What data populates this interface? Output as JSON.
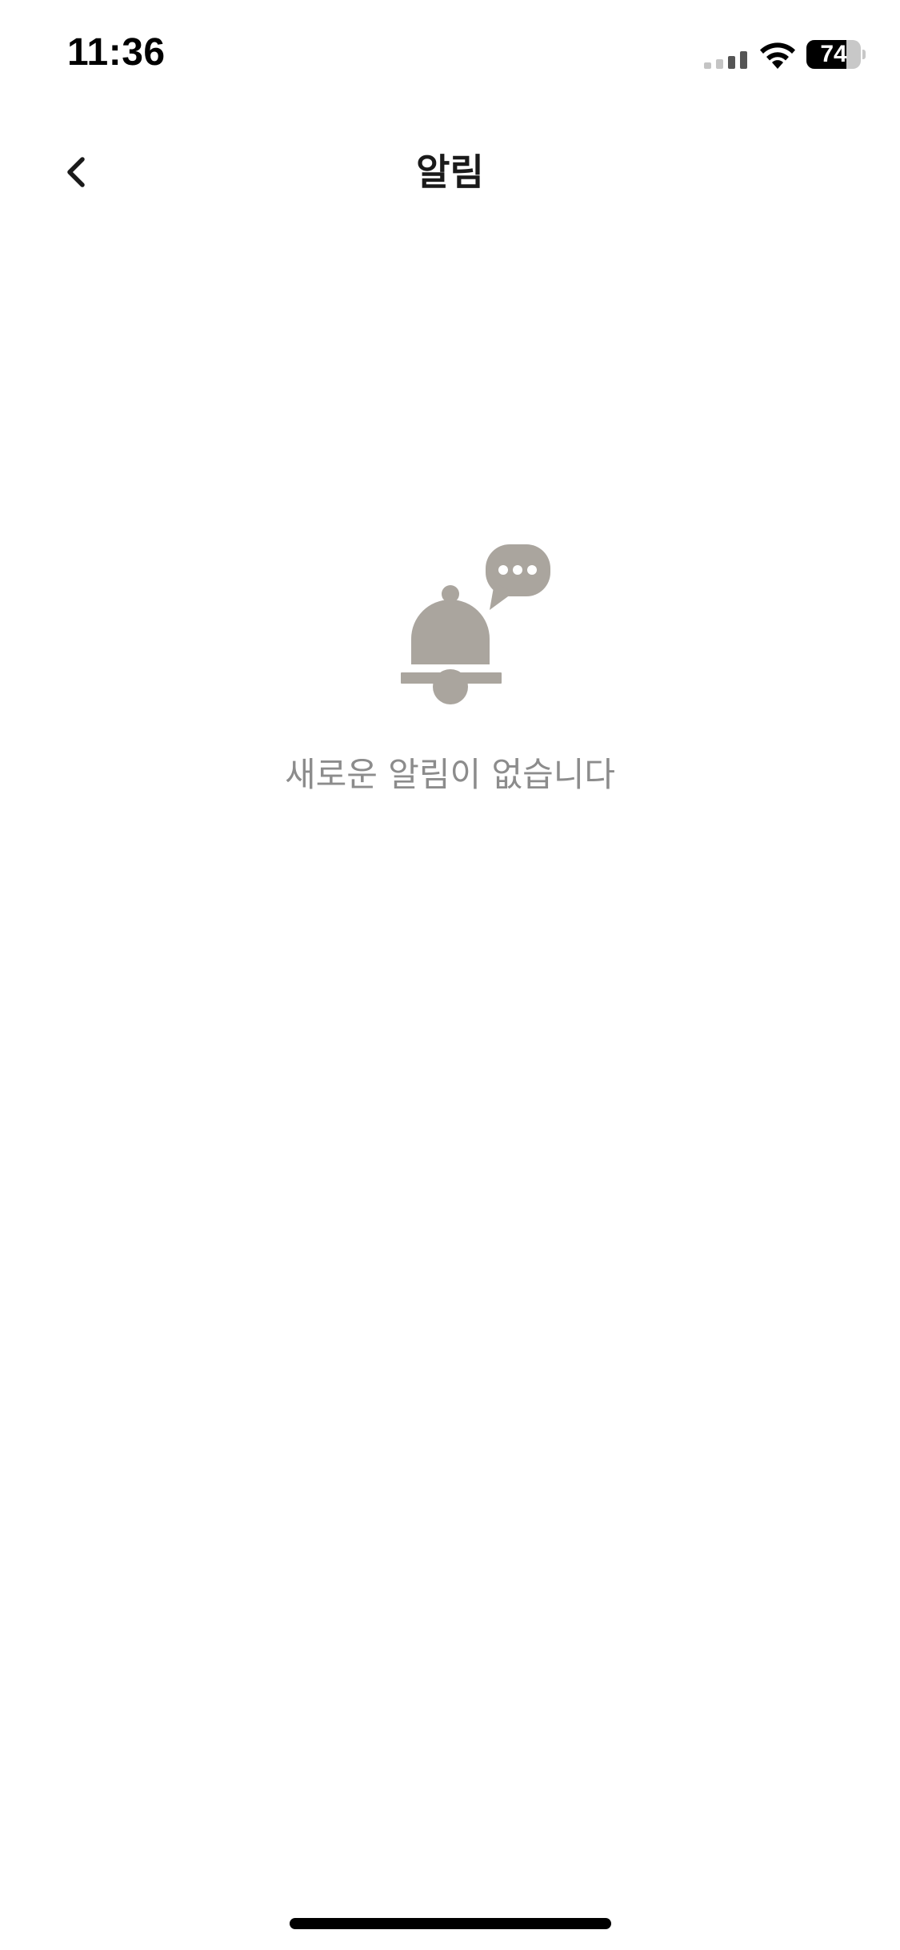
{
  "status_bar": {
    "time": "11:36",
    "battery_level": "74",
    "battery_fraction": 0.74,
    "icons": [
      "signal-icon",
      "wifi-icon",
      "battery-icon"
    ]
  },
  "header": {
    "title": "알림",
    "back_icon": "chevron-left-icon"
  },
  "empty_state": {
    "icon": "bell-with-chat-bubble-icon",
    "message": "새로운 알림이 없습니다"
  },
  "colors": {
    "illustration": "#aaa59e",
    "message_text": "#8c8c8c",
    "title_text": "#1a1a1a",
    "background": "#ffffff"
  }
}
